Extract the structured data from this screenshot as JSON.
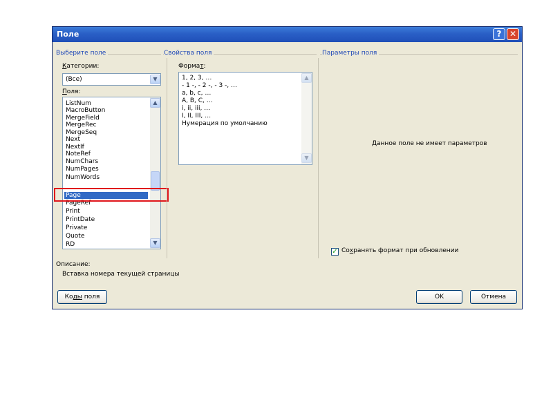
{
  "dialog": {
    "title": "Поле",
    "help_glyph": "?",
    "close_glyph": "✕"
  },
  "choose_field": {
    "group_title": "Выберите поле",
    "categories_label_u": "К",
    "categories_label_rest": "атегории:",
    "category_value": "(Все)",
    "fields_label_u": "П",
    "fields_label_rest": "оля:",
    "fields": [
      "ListNum",
      "MacroButton",
      "MergeField",
      "MergeRec",
      "MergeSeq",
      "Next",
      "NextIf",
      "NoteRef",
      "NumChars",
      "NumPages",
      "NumWords",
      "Page",
      "PageRef",
      "Print",
      "PrintDate",
      "Private",
      "Quote",
      "RD"
    ],
    "selected_field": "Page"
  },
  "field_properties": {
    "group_title": "Свойства поля",
    "format_label_a": "Форма",
    "format_label_u": "т",
    "format_label_b": ":",
    "formats": [
      "1, 2, 3, …",
      "- 1 -, - 2 -, - 3 -, …",
      "a, b, c, …",
      "A, B, C, …",
      "i, ii, iii, …",
      "I, II, III, …",
      "Нумерация по умолчанию"
    ]
  },
  "field_options": {
    "group_title": "Параметры поля",
    "no_params_text": "Данное поле не имеет параметров",
    "preserve_a": "Со",
    "preserve_u": "х",
    "preserve_b": "ранять формат при обновлении",
    "preserve_checked": true
  },
  "description": {
    "label": "Описание:",
    "text": "Вставка номера текущей страницы"
  },
  "buttons": {
    "field_codes_a": "Ко",
    "field_codes_u": "ды",
    "field_codes_b": " поля",
    "ok": "OK",
    "cancel": "Отмена"
  },
  "colors": {
    "titlebar": "#2a5fc6",
    "group_title": "#1f48b7",
    "selection": "#316ac5",
    "highlight_box": "#e0161b",
    "checkmark": "#21a121"
  },
  "icons": {
    "dropdown": "chevron-down-icon",
    "scroll_up": "chevron-up-icon",
    "scroll_down": "chevron-down-icon",
    "check": "checkmark-icon"
  }
}
